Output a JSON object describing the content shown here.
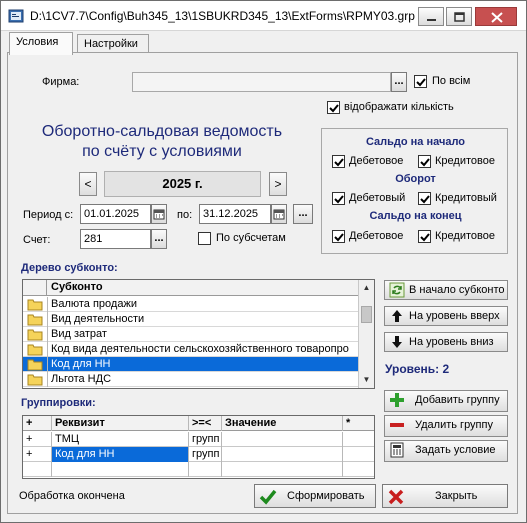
{
  "window": {
    "title": "D:\\1CV7.7\\Config\\Buh345_13\\1SBUKRD345_13\\ExtForms\\RPMY03.grp\\1..."
  },
  "tabs": [
    {
      "label": "Условия"
    },
    {
      "label": "Настройки"
    }
  ],
  "firm": {
    "label": "Фирма:",
    "value": "",
    "select_btn": "...",
    "all_label": "По всім",
    "all_checked": true
  },
  "show_qty": {
    "label": "відображати кількість",
    "checked": true
  },
  "heading": {
    "line1": "Оборотно-сальдовая ведомость",
    "line2": "по счёту с условиями"
  },
  "year": {
    "value": "2025 г.",
    "prev": "<",
    "next": ">"
  },
  "period": {
    "label_from": "Период с:",
    "from": "01.01.2025",
    "label_to": "по:",
    "to": "31.12.2025",
    "more_btn": "..."
  },
  "account": {
    "label": "Счет:",
    "value": "281",
    "select_btn": "...",
    "subaccounts_label": "По субсчетам",
    "subaccounts_checked": false
  },
  "saldo": {
    "start_title": "Сальдо на начало",
    "turnover_title": "Оборот",
    "end_title": "Сальдо на конец",
    "start": {
      "debit": "Дебетовое",
      "credit": "Кредитовое"
    },
    "turnover": {
      "debit": "Дебетовый",
      "credit": "Кредитовый"
    },
    "end": {
      "debit": "Дебетовое",
      "credit": "Кредитовое"
    }
  },
  "tree": {
    "section_label": "Дерево субконто:",
    "header": "Субконто",
    "rows": [
      {
        "label": "Валюта продажи",
        "selected": false
      },
      {
        "label": "Вид деятельности",
        "selected": false
      },
      {
        "label": "Вид затрат",
        "selected": false
      },
      {
        "label": "Код вида деятельности сельскохозяйственного товаропро",
        "selected": false
      },
      {
        "label": "Код для НН",
        "selected": true
      },
      {
        "label": "Льгота НДС",
        "selected": false
      }
    ]
  },
  "right_buttons": {
    "to_start": "В начало субконто",
    "level_up": "На уровень вверх",
    "level_down": "На уровень вниз",
    "level_text": "Уровень: 2",
    "add_group": "Добавить группу",
    "remove_group": "Удалить группу",
    "set_condition": "Задать условие"
  },
  "groupings": {
    "section_label": "Группировки:",
    "columns": [
      "+",
      "Реквизит",
      ">=<",
      "Значение",
      "*"
    ],
    "rows": [
      {
        "plus": "+",
        "field": "ТМЦ",
        "op": "групп",
        "value": "",
        "star": ""
      },
      {
        "plus": "+",
        "field": "Код для НН",
        "op": "групп",
        "value": "",
        "star": ""
      }
    ]
  },
  "status": "Обработка окончена",
  "form_btn": "Сформировать",
  "close_btn": "Закрыть",
  "colors": {
    "accent": "#1e2a7a",
    "selection": "#0a6ad9"
  }
}
